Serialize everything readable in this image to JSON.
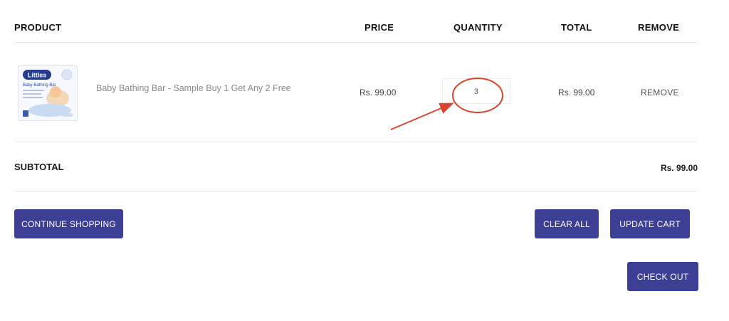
{
  "table": {
    "headers": {
      "product": "PRODUCT",
      "price": "PRICE",
      "quantity": "QUANTITY",
      "total": "TOTAL",
      "remove": "REMOVE"
    },
    "row": {
      "thumbnail_brand": "Littles",
      "thumbnail_caption": "Baby Bathing Bar",
      "product_name": "Baby Bathing Bar - Sample Buy 1 Get Any 2 Free",
      "price": "Rs. 99.00",
      "quantity": "3",
      "total": "Rs. 99.00",
      "remove_label": "REMOVE"
    }
  },
  "summary": {
    "subtotal_label": "SUBTOTAL",
    "subtotal_value": "Rs. 99.00"
  },
  "actions": {
    "continue_shopping": "CONTINUE SHOPPING",
    "clear_all": "CLEAR ALL",
    "update_cart": "UPDATE CART",
    "check_out": "CHECK OUT"
  },
  "colors": {
    "button": "#3d3f95",
    "annotation": "#d9442b",
    "divider": "#e6e6e6"
  }
}
